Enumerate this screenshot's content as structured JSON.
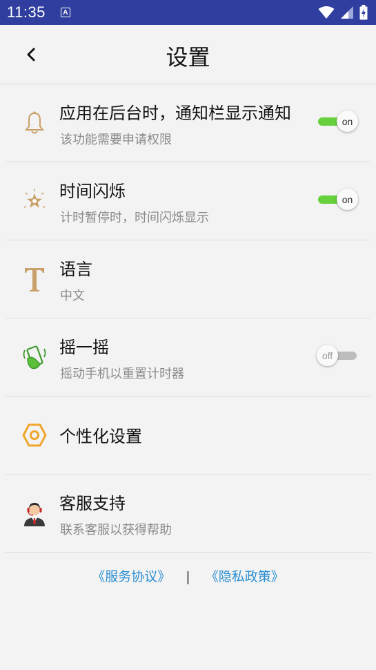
{
  "status_bar": {
    "time": "11:35",
    "notification_icon": "a-badge-icon",
    "icons": [
      "wifi-icon",
      "cell-signal-icon",
      "battery-charging-icon"
    ]
  },
  "header": {
    "back_icon": "chevron-left-icon",
    "title": "设置"
  },
  "settings": [
    {
      "title": "应用在后台时，通知栏显示通知",
      "subtitle": "该功能需要申请权限",
      "icon": "bell-icon",
      "toggle": "on"
    },
    {
      "title": "时间闪烁",
      "subtitle": "计时暂停时，时间闪烁显示",
      "icon": "star-sparkle-icon",
      "toggle": "on"
    },
    {
      "title": "语言",
      "subtitle": "中文",
      "icon": "text-t-icon"
    },
    {
      "title": "摇一摇",
      "subtitle": "摇动手机以重置计时器",
      "icon": "shake-phone-icon",
      "toggle": "off"
    },
    {
      "title": "个性化设置",
      "icon": "hexagon-settings-icon"
    },
    {
      "title": "客服支持",
      "subtitle": "联系客服以获得帮助",
      "icon": "customer-service-icon"
    }
  ],
  "footer": {
    "terms_link": "《服务协议》",
    "separator": "|",
    "privacy_link": "《隐私政策》"
  },
  "colors": {
    "status_bar": "#303f9f",
    "toggle_on": "#66d13d",
    "toggle_off": "#bdbdbd",
    "link": "#2a8fd0",
    "icon_gold": "#c8a06a"
  }
}
